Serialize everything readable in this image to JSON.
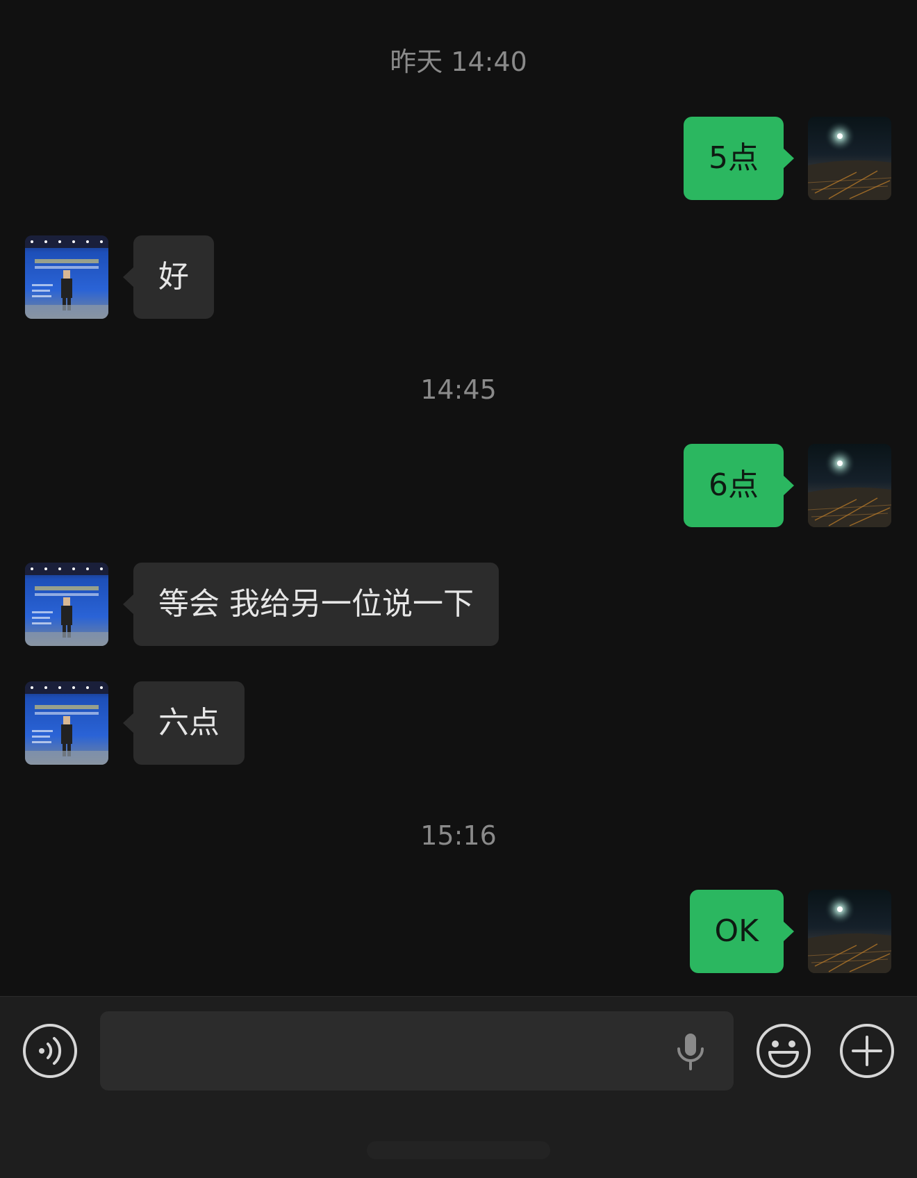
{
  "timestamps": [
    "昨天 14:40",
    "14:45",
    "15:16"
  ],
  "messages": [
    {
      "side": "out",
      "text": "5点"
    },
    {
      "side": "in",
      "text": "好"
    },
    {
      "side": "out",
      "text": "6点"
    },
    {
      "side": "in",
      "text": "等会 我给另一位说一下"
    },
    {
      "side": "in",
      "text": "六点"
    },
    {
      "side": "out",
      "text": "OK"
    }
  ],
  "input_bar": {
    "voice_icon": "voice-wave-icon",
    "mic_icon": "microphone-icon",
    "emoji_icon": "smiley-icon",
    "plus_icon": "plus-icon",
    "text_value": ""
  },
  "colors": {
    "background": "#111111",
    "outgoing_bubble": "#2bb760",
    "incoming_bubble": "#2c2c2c",
    "timestamp": "#8a8a8a",
    "input_bar": "#1e1e1e"
  }
}
